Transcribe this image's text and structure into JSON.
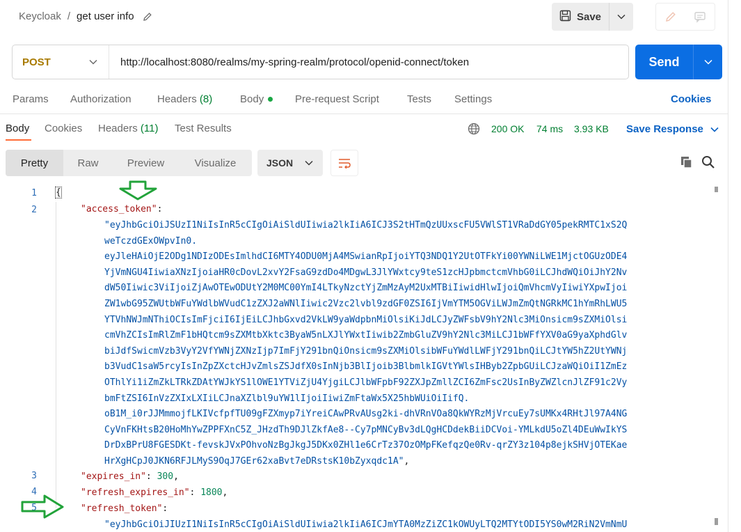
{
  "header": {
    "breadcrumb_parent": "Keycloak",
    "breadcrumb_sep": "/",
    "request_name": "get user info",
    "save_label": "Save"
  },
  "request": {
    "method": "POST",
    "url": "http://localhost:8080/realms/my-spring-realm/protocol/openid-connect/token",
    "send_label": "Send"
  },
  "request_tabs": {
    "params": "Params",
    "authorization": "Authorization",
    "headers": "Headers",
    "headers_count": "(8)",
    "body": "Body",
    "pre_request": "Pre-request Script",
    "tests": "Tests",
    "settings": "Settings",
    "cookies": "Cookies"
  },
  "response_tabs": {
    "body": "Body",
    "cookies": "Cookies",
    "headers": "Headers",
    "headers_count": "(11)",
    "test_results": "Test Results",
    "status": "200 OK",
    "time": "74 ms",
    "size": "3.93 KB",
    "save_response": "Save Response"
  },
  "view": {
    "pretty": "Pretty",
    "raw": "Raw",
    "preview": "Preview",
    "visualize": "Visualize",
    "format": "JSON"
  },
  "code": {
    "line_numbers": [
      "1",
      "2",
      "3",
      "4",
      "5"
    ],
    "open_brace": "{",
    "key_access_token": "\"access_token\"",
    "access_token_lines": [
      "\"eyJhbGciOiJSUzI1NiIsInR5cCIgOiAiSldUIiwia2lkIiA6ICJ3S2tHTmQzUUxscFU5VWlST1VRaDdGY05pekRMTC1xS2Q",
      "weTczdGExOWpvIn0.",
      "eyJleHAiOjE2ODg1NDIzODEsImlhdCI6MTY4ODU0MjA4MSwianRpIjoiYTQ3NDQ1Y2UtOTFkYi00YWNiLWE1MjctOGUzODE4",
      "YjVmNGU4IiwiaXNzIjoiaHR0cDovL2xvY2FsaG9zdDo4MDgwL3JlYWxtcy9teS1zcHJpbmctcmVhbG0iLCJhdWQiOiJhY2Nv",
      "dW50Iiwic3ViIjoiZjAwOTEwODUtY2M0MC00YmI4LTkyNzctYjZmMzAyM2UxMTBiIiwidHlwIjoiQmVhcmVyIiwiYXpwIjoi",
      "ZW1wbG95ZWUtbWFuYWdlbWVudC1zZXJ2aWNlIiwic2Vzc2lvbl9zdGF0ZSI6IjVmYTM5OGViLWJmZmQtNGRkMC1hYmRhLWU5",
      "YTVhNWJmNThiOCIsImFjciI6IjEiLCJhbGxvd2VkLW9yaWdpbnMiOlsiKiJdLCJyZWFsbV9hY2Nlc3MiOnsicm9sZXMiOlsi",
      "cmVhZCIsImRlZmF1bHQtcm9sZXMtbXktc3ByaW5nLXJlYWxtIiwib2ZmbGluZV9hY2Nlc3MiLCJ1bWFfYXV0aG9yaXphdGlv",
      "biJdfSwicmVzb3VyY2VfYWNjZXNzIjp7ImFjY291bnQiOnsicm9sZXMiOlsibWFuYWdlLWFjY291bnQiLCJtYW5hZ2UtYWNj",
      "b3VudC1saW5rcyIsInZpZXctcHJvZmlsZSJdfX0sInNjb3BlIjoib3BlbmlkIGVtYWlsIHByb2ZpbGUiLCJzaWQiOiI1ZmEz",
      "OThlYi1iZmZkLTRkZDAtYWJkYS1lOWE1YTViZjU4YjgiLCJlbWFpbF92ZXJpZmllZCI6ZmFsc2UsInByZWZlcnJlZF91c2Vy",
      "bmFtZSI6InVzZXIxLXIiLCJnaXZlbl9uYW1lIjoiIiwiZmFtaWx5X25hbWUiOiIifQ.",
      "oB1M_i0rJJMmmojfLKIVcfpfTU09gFZXmyp7iYreiCAwPRvAUsg2ki-dhVRnVOa8QkWYRzMjVrcuEy7sUMKx4RHtJl97A4NG",
      "CyVnFKHtsB20HoMhYwZPPFXnC5Z_JHzdTh9DJlZkfAe8--Cy7pMNCyBv3dLQgHCDdekBiiDCVoi-YMLkdU5oZl4DEuWwIkYS",
      "DrDxBPrU8FGESDKt-fevskJVxPOhvoNzBgJkgJ5DKx0ZHl1e6CrTz37OzOMpFKefqzQe0Rv-qrZY3z104p8ejkSHVjOTEKae",
      "HrXgHCpJ0JKN6RFJLMyS9OqJ7GEr62xaBvt7eDRstsK10bZyxqdc1A\""
    ],
    "key_expires_in": "\"expires_in\"",
    "expires_in": "300",
    "key_refresh_expires_in": "\"refresh_expires_in\"",
    "refresh_expires_in": "1800",
    "key_refresh_token": "\"refresh_token\"",
    "refresh_token_partial": "\"eyJhbGciOiJIUzI1NiIsInR5cCIgOiAiSldUIiwia2lkIiA6ICJmYTA0MzZiZC1kOWUyLTQ2MTYtODI5YS0wM2RiN2VmNmU"
  },
  "colors": {
    "send_blue": "#0b6ee3",
    "method_gold": "#a87a00",
    "status_green": "#007f31",
    "arrow_green": "#22a33a"
  },
  "icons": [
    "pencil-icon",
    "save-disk-icon",
    "chevron-down-icon",
    "edit-icon",
    "comment-icon",
    "globe-icon",
    "wrap-icon",
    "copy-icon",
    "search-icon",
    "arrow-annotation"
  ]
}
